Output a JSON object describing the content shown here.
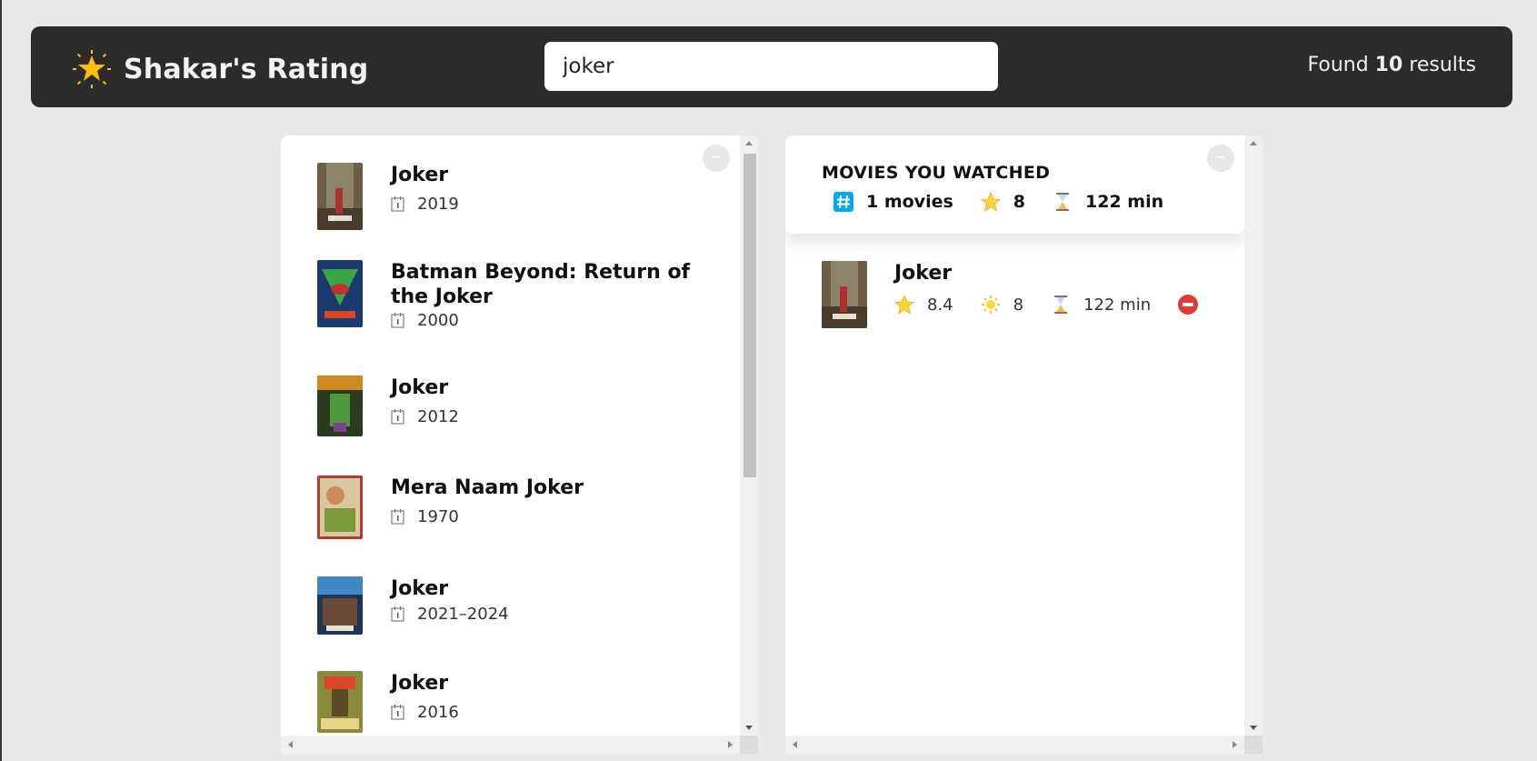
{
  "app": {
    "title": "Shakar's Rating",
    "logo_icon": "glowing-star-icon"
  },
  "search": {
    "value": "joker"
  },
  "results": {
    "prefix": "Found",
    "count": "10",
    "suffix": "results"
  },
  "search_results": [
    {
      "title": "Joker",
      "year": "2019"
    },
    {
      "title": "Batman Beyond: Return of the Joker",
      "year": "2000"
    },
    {
      "title": "Joker",
      "year": "2012"
    },
    {
      "title": "Mera Naam Joker",
      "year": "1970"
    },
    {
      "title": "Joker",
      "year": "2021–2024"
    },
    {
      "title": "Joker",
      "year": "2016"
    }
  ],
  "summary": {
    "title": "MOVIES YOU WATCHED",
    "count": "1 movies",
    "avg_imdb": "8",
    "runtime": "122 min"
  },
  "watched": [
    {
      "title": "Joker",
      "imdb_rating": "8.4",
      "user_rating": "8",
      "runtime": "122 min"
    }
  ],
  "colors": {
    "navbar": "#2b2b2b",
    "background": "#e8e8e8",
    "remove": "#e53935",
    "star": "#fdd835",
    "hash": "#03a9f4"
  }
}
